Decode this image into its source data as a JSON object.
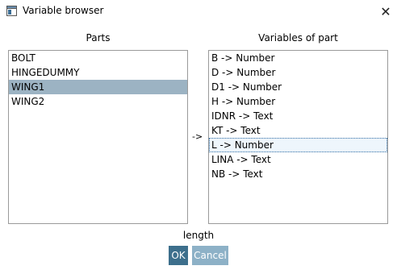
{
  "window": {
    "title": "Variable browser",
    "close_glyph": "✕"
  },
  "parts": {
    "header": "Parts",
    "items": [
      "BOLT",
      "HINGEDUMMY",
      "WING1",
      "WING2"
    ],
    "selected": "WING1"
  },
  "variables": {
    "header": "Variables of part",
    "items": [
      "B -> Number",
      "D -> Number",
      "D1 -> Number",
      "H -> Number",
      "IDNR -> Text",
      "KT -> Text",
      "L -> Number",
      "LINA -> Text",
      "NB -> Text"
    ],
    "focused": "L -> Number"
  },
  "arrow_label": "->",
  "description": "length",
  "buttons": {
    "ok": "OK",
    "cancel": "Cancel"
  },
  "colors": {
    "selected_part": "#9cb3c3",
    "ok_button": "#3d6f8c",
    "cancel_button": "#8db1c7"
  }
}
